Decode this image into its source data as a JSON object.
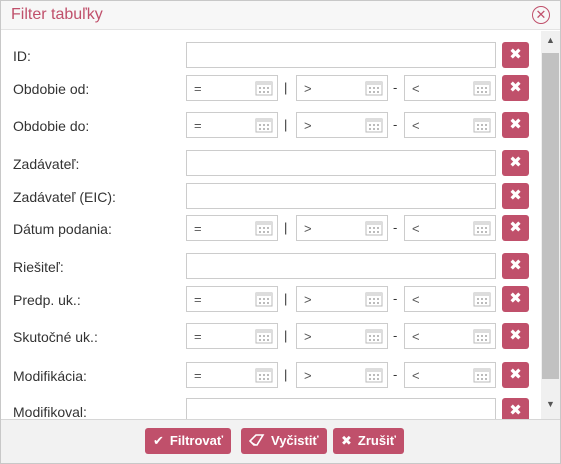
{
  "dialog": {
    "title": "Filter tabuľky",
    "close_glyph": "✕"
  },
  "fields": {
    "id": {
      "label": "ID:"
    },
    "obdobie_od": {
      "label": "Obdobie od:",
      "op1": "=",
      "op2": ">",
      "op3": "<"
    },
    "obdobie_do": {
      "label": "Obdobie do:",
      "op1": "=",
      "op2": ">",
      "op3": "<"
    },
    "zadavatel": {
      "label": "Zadávateľ:"
    },
    "zadavatel_eic": {
      "label": "Zadávateľ (EIC):"
    },
    "datum_podania": {
      "label": "Dátum podania:",
      "op1": "=",
      "op2": ">",
      "op3": "<"
    },
    "riesitel": {
      "label": "Riešiteľ:"
    },
    "predp_uk": {
      "label": "Predp. uk.:",
      "op1": "=",
      "op2": ">",
      "op3": "<"
    },
    "skutocne_uk": {
      "label": "Skutočné uk.:",
      "op1": "=",
      "op2": ">",
      "op3": "<"
    },
    "modifikacia": {
      "label": "Modifikácia:",
      "op1": "=",
      "op2": ">",
      "op3": "<"
    },
    "modifikoval": {
      "label": "Modifikoval:"
    }
  },
  "separators": {
    "pipe": "|",
    "dash": "-"
  },
  "clear_glyph": "✖",
  "footer": {
    "filter": {
      "label": "Filtrovať",
      "icon": "✔"
    },
    "clear": {
      "label": "Vyčistiť",
      "icon": "eraser-icon"
    },
    "cancel": {
      "label": "Zrušiť",
      "icon": "✖"
    }
  },
  "colors": {
    "accent": "#c0506b"
  }
}
